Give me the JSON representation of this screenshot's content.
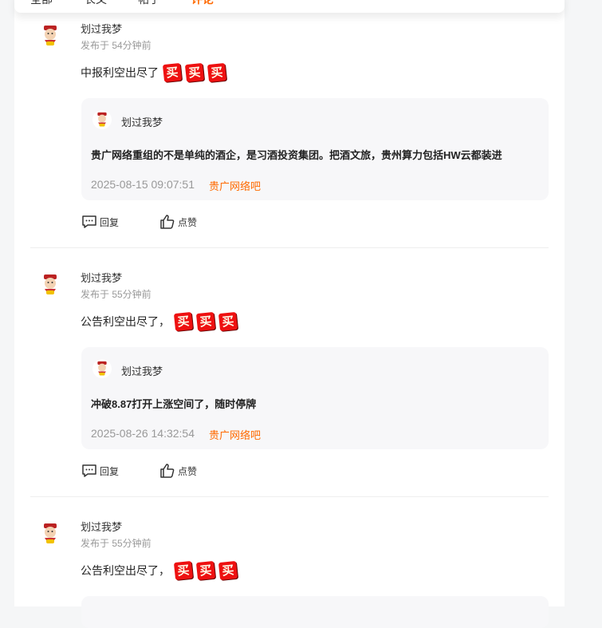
{
  "tabs": [
    {
      "label": "全部"
    },
    {
      "label": "长文"
    },
    {
      "label": "帖子"
    },
    {
      "label": "评论"
    }
  ],
  "posts": [
    {
      "username": "划过我梦",
      "time": "发布于 54分钟前",
      "content": "中报利空出尽了",
      "emojis": [
        "买",
        "买",
        "买"
      ],
      "quote": {
        "username": "划过我梦",
        "text": "贵广网络重组的不是单纯的酒企，是习酒投资集团。把酒文旅，贵州算力包括HW云都装进",
        "date": "2025-08-15 09:07:51",
        "forum": "贵广网络吧"
      },
      "reply_label": "回复",
      "like_label": "点赞"
    },
    {
      "username": "划过我梦",
      "time": "发布于 55分钟前",
      "content": "公告利空出尽了，",
      "emojis": [
        "买",
        "买",
        "买"
      ],
      "quote": {
        "username": "划过我梦",
        "text": "冲破8.87打开上涨空间了，随时停牌",
        "date": "2025-08-26 14:32:54",
        "forum": "贵广网络吧"
      },
      "reply_label": "回复",
      "like_label": "点赞"
    },
    {
      "username": "划过我梦",
      "time": "发布于 55分钟前",
      "content": "公告利空出尽了，",
      "emojis": [
        "买",
        "买",
        "买"
      ]
    }
  ],
  "colors": {
    "accent": "#ff6a00",
    "muted": "#999999",
    "quote_bg": "#f7f7f9"
  }
}
